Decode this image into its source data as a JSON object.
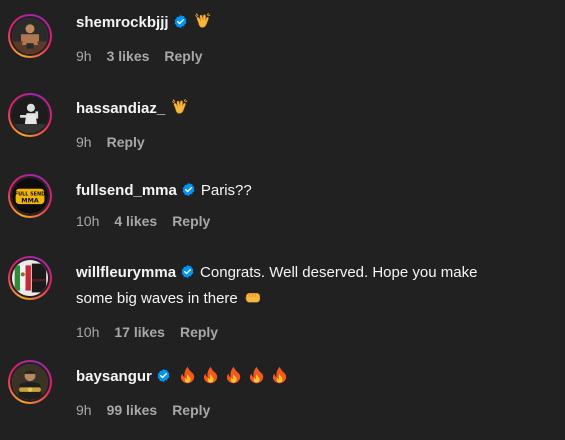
{
  "comments": [
    {
      "username": "shemrockbjjj",
      "verified": true,
      "text": "",
      "emojis": [
        "clap"
      ],
      "time": "9h",
      "likes": "3 likes",
      "reply": "Reply"
    },
    {
      "username": "hassandiaz_",
      "verified": false,
      "text": "",
      "emojis": [
        "clap"
      ],
      "time": "9h",
      "likes": "",
      "reply": "Reply"
    },
    {
      "username": "fullsend_mma",
      "verified": true,
      "text": "Paris??",
      "emojis": [],
      "time": "10h",
      "likes": "4 likes",
      "reply": "Reply",
      "avatar_text_1": "FULL SEND",
      "avatar_text_2": "MMA"
    },
    {
      "username": "willfleurymma",
      "verified": true,
      "text": "Congrats. Well deserved. Hope you make",
      "text_line2": "some big waves in there",
      "emojis": [
        "fist"
      ],
      "time": "10h",
      "likes": "17 likes",
      "reply": "Reply"
    },
    {
      "username": "baysangur",
      "verified": true,
      "text": "",
      "emojis": [
        "fire",
        "fire",
        "fire",
        "fire",
        "fire"
      ],
      "time": "9h",
      "likes": "99 likes",
      "reply": "Reply"
    }
  ],
  "colors": {
    "background": "#212121",
    "text": "#f5f5f5",
    "muted": "#a8a8a8",
    "verified": "#0095f6"
  }
}
